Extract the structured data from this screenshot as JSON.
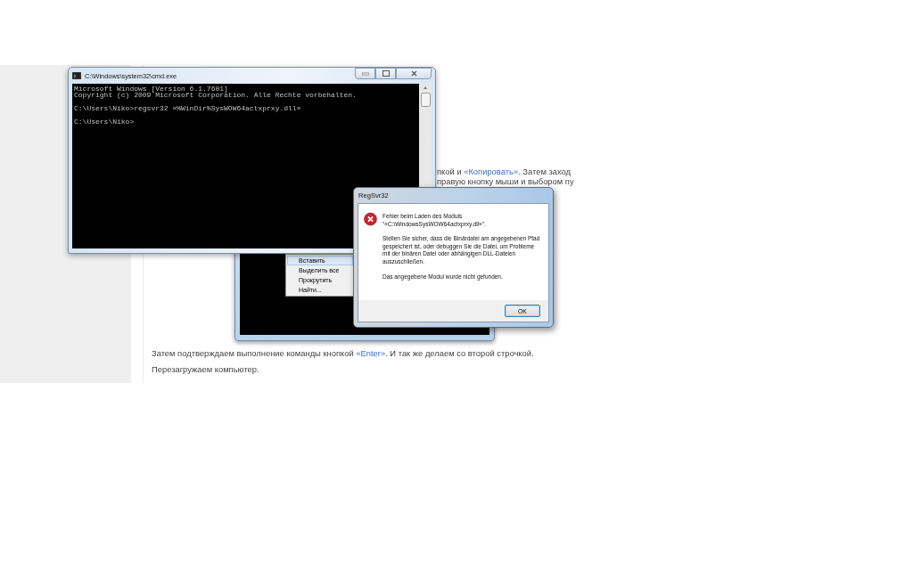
{
  "article": {
    "lines": [
      {
        "runs": [
          {
            "text": "пкой и "
          },
          {
            "text": "«Копировать»",
            "kind": "link"
          },
          {
            "text": ". Затем заход"
          }
        ]
      },
      {
        "runs": [
          {
            "text": "правую кнопку мыши и выбором пу"
          }
        ]
      },
      {
        "runs": [
          {
            "text": "Затем подтверждаем выполнение команды кнопкой "
          },
          {
            "text": "«Enter»",
            "kind": "link"
          },
          {
            "text": ". И так же делаем со второй строчкой."
          }
        ]
      },
      {
        "runs": [
          {
            "text": "Перезагружаем компьютер."
          }
        ]
      }
    ]
  },
  "back_console": {
    "context_menu": [
      {
        "label": "Вставить",
        "selected": true
      },
      {
        "label": "Выделить все",
        "selected": false
      },
      {
        "label": "Прокрутить",
        "selected": false
      },
      {
        "label": "Найти...",
        "selected": false
      }
    ]
  },
  "console": {
    "title": "C:\\Windows\\system32\\cmd.exe",
    "blocks": [
      [
        "Microsoft Windows [Version 6.1.7601]",
        "Copyright (c) 2009 Microsoft Corporation. Alle Rechte vorbehalten."
      ],
      [
        "C:\\Users\\Niko>regsvr32 «%WinDir%SysWOW64actxprxy.dll»"
      ],
      [
        "C:\\Users\\Niko>"
      ]
    ]
  },
  "dialog": {
    "title": "RegSvr32",
    "messages": [
      "Fehler beim Laden des Moduls \"«C:\\WindowsSysWOW64actxprxy.dll»\".",
      "Stellen Sie sicher, dass die Binärdatei am angegebenen Pfad gespeichert ist, oder debuggen Sie die Datei, um Probleme mit der binären Datei oder abhängigen DLL-Dateien auszuschließen.",
      "Das angegebene Modul wurde nicht gefunden."
    ],
    "buttons": [
      "OK"
    ]
  }
}
